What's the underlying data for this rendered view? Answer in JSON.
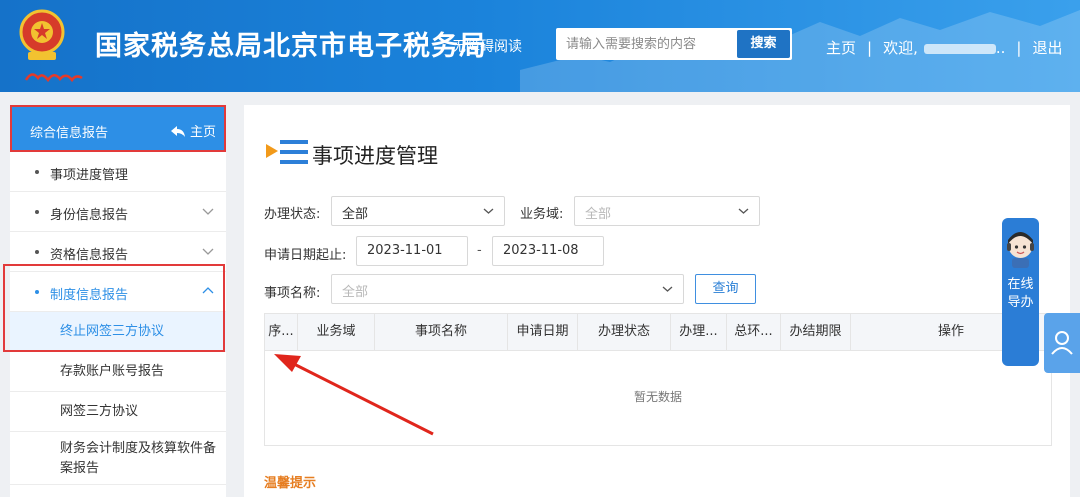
{
  "header": {
    "site_title": "国家税务总局北京市电子税务局",
    "accessibility_label": "无障碍阅读",
    "search_placeholder": "请输入需要搜索的内容",
    "search_button": "搜索",
    "nav_home": "主页",
    "nav_separator": "|",
    "nav_welcome": "欢迎,",
    "nav_ellipsis": "..",
    "nav_logout": "退出",
    "brand_color": "#1b83db"
  },
  "sidebar": {
    "title": "综合信息报告",
    "home_link": "主页",
    "items": [
      {
        "label": "事项进度管理",
        "expandable": false
      },
      {
        "label": "身份信息报告",
        "expandable": true
      },
      {
        "label": "资格信息报告",
        "expandable": true
      },
      {
        "label": "制度信息报告",
        "expandable": true,
        "expanded": true,
        "active": true
      }
    ],
    "sub_items": [
      {
        "label": "终止网签三方协议",
        "active": true
      },
      {
        "label": "存款账户账号报告"
      },
      {
        "label": "网签三方协议"
      },
      {
        "label": "财务会计制度及核算软件备案报告"
      }
    ],
    "active_color": "#2d8fe6",
    "highlight_color": "#e23a3a"
  },
  "main": {
    "page_title": "事项进度管理",
    "filters": {
      "status_label": "办理状态:",
      "status_value": "全部",
      "domain_label": "业务域:",
      "domain_placeholder": "全部",
      "date_label": "申请日期起止:",
      "date_start": "2023-11-01",
      "date_sep": "-",
      "date_end": "2023-11-08",
      "name_label": "事项名称:",
      "name_placeholder": "全部",
      "query_button": "查询"
    },
    "table": {
      "columns": [
        "序...",
        "业务域",
        "事项名称",
        "申请日期",
        "办理状态",
        "办理...",
        "总环...",
        "办结期限",
        "操作"
      ],
      "empty_text": "暂无数据"
    },
    "tips_title": "温馨提示"
  },
  "guide": {
    "label": "在线导办"
  }
}
